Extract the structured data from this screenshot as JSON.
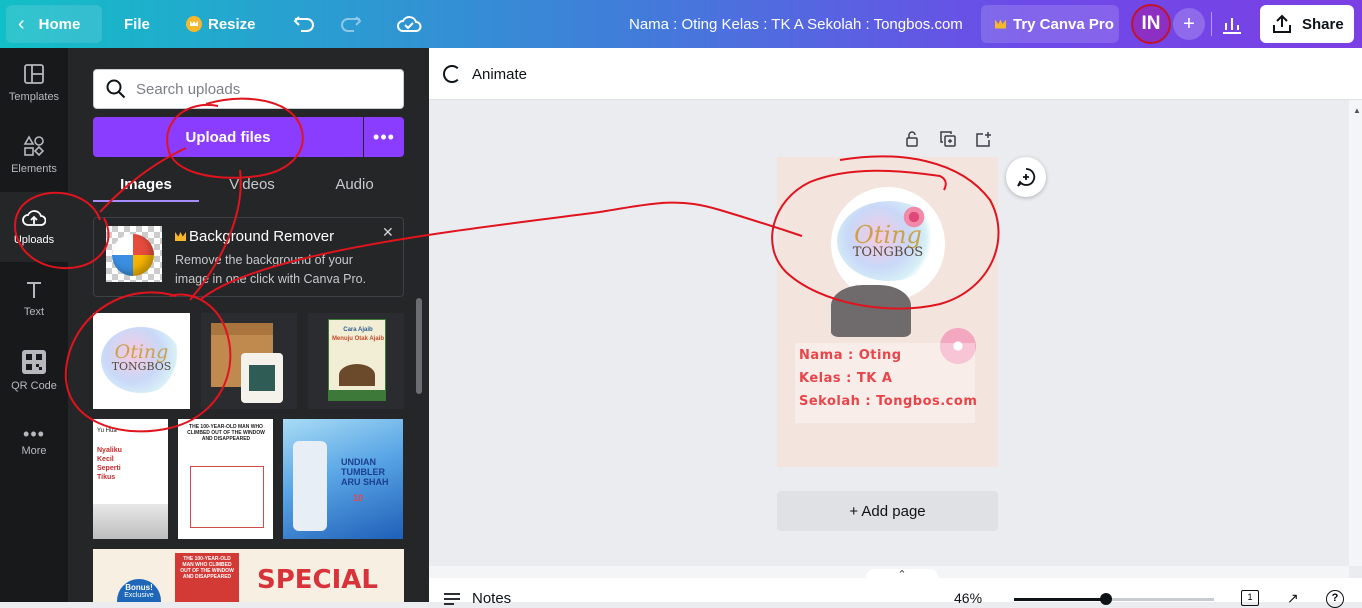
{
  "topbar": {
    "home_label": "Home",
    "file_label": "File",
    "resize_label": "Resize",
    "doc_title": "Nama : Oting Kelas : TK A Sekolah : Tongbos.com",
    "try_pro_label": "Try Canva Pro",
    "avatar_initials": "IN",
    "share_label": "Share"
  },
  "rail": {
    "items": [
      {
        "label": "Templates",
        "icon": "templates-icon"
      },
      {
        "label": "Elements",
        "icon": "elements-icon"
      },
      {
        "label": "Uploads",
        "icon": "cloud-upload-icon",
        "active": true
      },
      {
        "label": "Text",
        "icon": "text-icon"
      },
      {
        "label": "QR Code",
        "icon": "qr-code-icon"
      },
      {
        "label": "More",
        "icon": "more-icon"
      }
    ]
  },
  "uploads_panel": {
    "search_placeholder": "Search uploads",
    "upload_button": "Upload files",
    "tabs": [
      {
        "label": "Images",
        "active": true
      },
      {
        "label": "Videos"
      },
      {
        "label": "Audio"
      }
    ],
    "promo": {
      "title": "Background Remover",
      "description": "Remove the background of your image in one click with Canva Pro."
    },
    "thumbnails": [
      {
        "name": "oting-tongbos-logo",
        "text": [
          "Oting",
          "TONGBOS"
        ]
      },
      {
        "name": "box-and-candle-photo"
      },
      {
        "name": "cara-ajaib-book-cover",
        "text": [
          "Cara Ajaib",
          "Menuju Otak Ajaib"
        ]
      },
      {
        "name": "yu-hua-book-cover",
        "text": [
          "Yu Hua",
          "Nyaliku Kecil Seperti Tikus"
        ]
      },
      {
        "name": "100-year-old-man-page",
        "text": [
          "THE 100-YEAR-OLD MAN WHO CLIMBED OUT OF THE WINDOW AND DISAPPEARED"
        ]
      },
      {
        "name": "undian-tumbler-banner",
        "text": [
          "UNDIAN TUMBLER ARU SHAH",
          "10"
        ]
      },
      {
        "name": "special-offer-banner",
        "text": [
          "Bonus!",
          "Exclusive",
          "SPECIAL",
          "THE 100-YEAR-OLD MAN WHO CLIMBED OUT OF THE WINDOW AND DISAPPEARED"
        ]
      }
    ]
  },
  "editor": {
    "animate_label": "Animate",
    "page": {
      "logo_script": "Oting",
      "logo_word": "TONGBOS",
      "lines": [
        "Nama : Oting",
        "Kelas : TK A",
        "Sekolah : Tongbos.com"
      ]
    },
    "add_page_label": "+ Add page"
  },
  "footer": {
    "notes_label": "Notes",
    "zoom_label": "46%",
    "zoom_level": 0.46,
    "page_count": "1"
  },
  "colors": {
    "accent_purple": "#8b3dff",
    "annotation_red": "#e0141e",
    "page_text_red": "#e8454a"
  }
}
